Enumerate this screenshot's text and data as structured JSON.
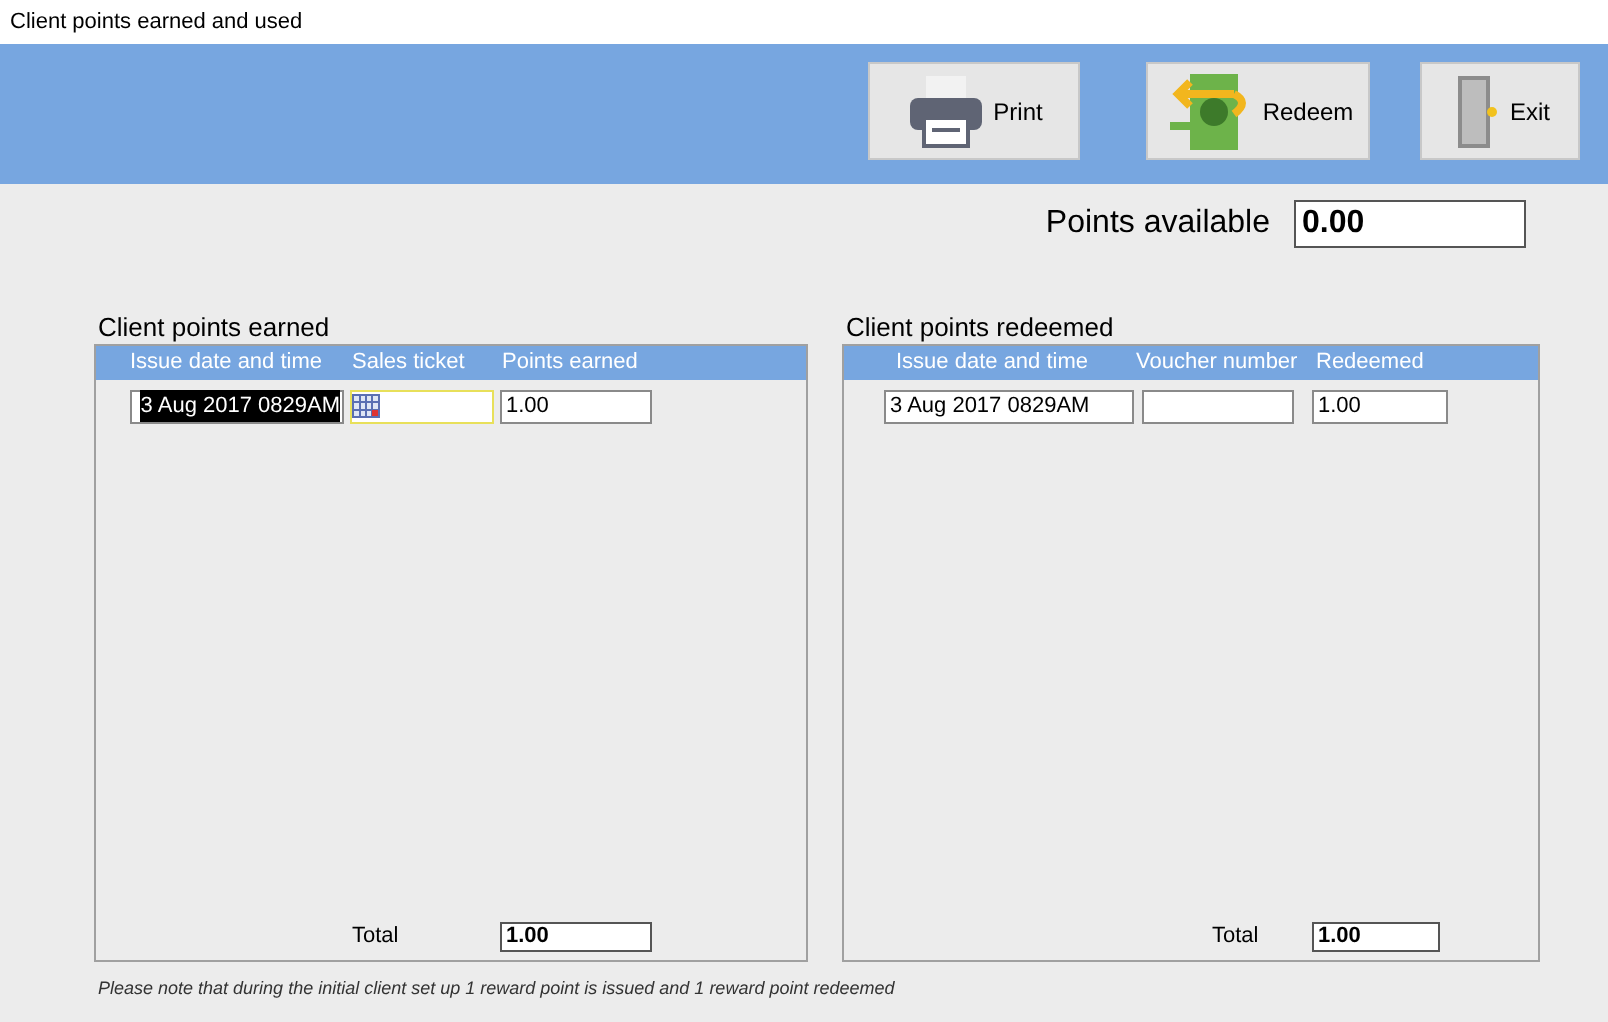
{
  "window": {
    "title": "Client points earned and used"
  },
  "toolbar": {
    "buttons": [
      {
        "label": "Print",
        "kind": "print"
      },
      {
        "label": "Redeem",
        "kind": "redeem"
      },
      {
        "label": "Exit",
        "kind": "exit"
      }
    ]
  },
  "points_available": {
    "label": "Points available",
    "value": "0.00"
  },
  "earned": {
    "title": "Client points earned",
    "columns": [
      "Issue date and time",
      "Sales ticket",
      "Points earned"
    ],
    "rows": [
      {
        "date": "3 Aug 2017 0829AM",
        "date_selected": true,
        "ticket_focused": true,
        "points": "1.00"
      }
    ],
    "total_label": "Total",
    "total": "1.00"
  },
  "redeemed": {
    "title": "Client points redeemed",
    "columns": [
      "Issue date and time",
      "Voucher number",
      "Redeemed"
    ],
    "rows": [
      {
        "date": "3 Aug 2017 0829AM",
        "date_selected": false,
        "redeemed": "1.00"
      }
    ],
    "total_label": "Total",
    "total": "1.00"
  },
  "note": "Please note that during the  initial client set up 1 reward point is issued and 1 reward point redeemed"
}
